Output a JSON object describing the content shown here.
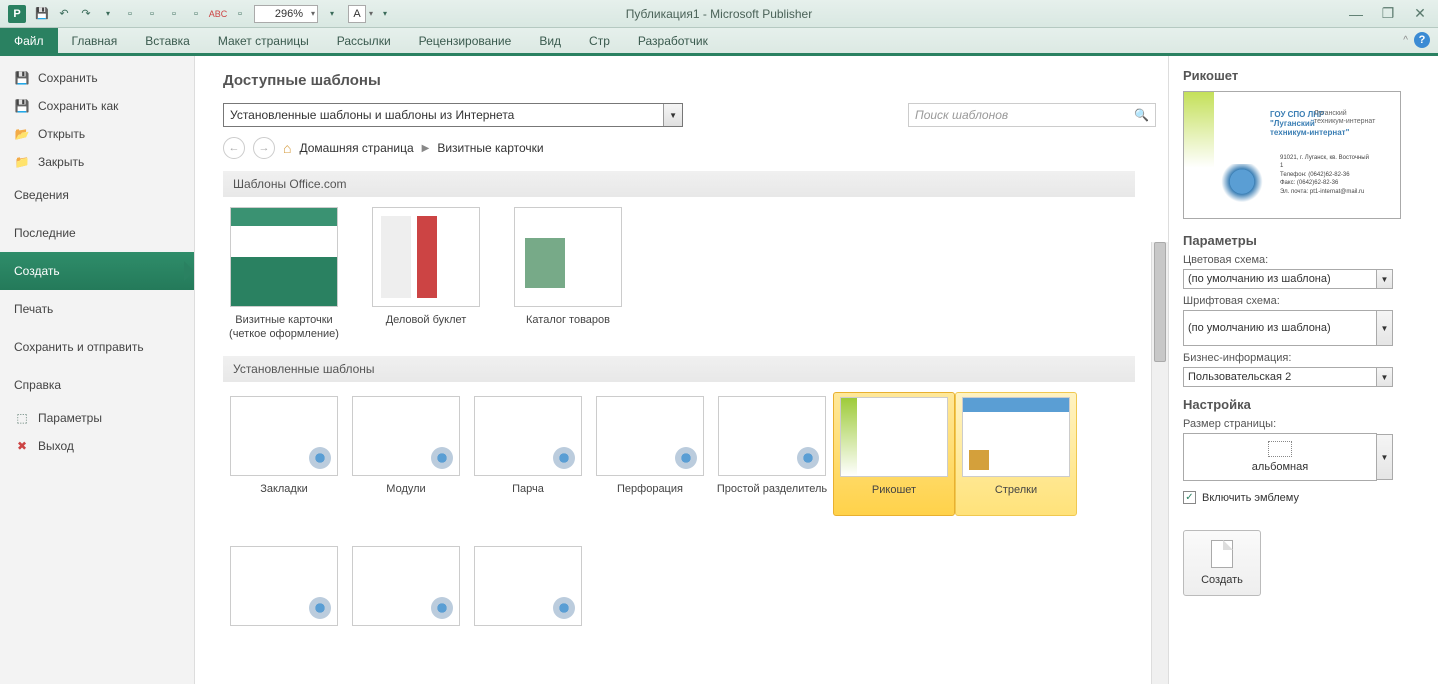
{
  "titlebar": {
    "app_icon_letter": "P",
    "zoom_value": "296%",
    "a_box": "A",
    "window_title": "Публикация1 - Microsoft Publisher"
  },
  "ribbon": {
    "tabs": [
      "Файл",
      "Главная",
      "Вставка",
      "Макет страницы",
      "Рассылки",
      "Рецензирование",
      "Вид",
      "Стр",
      "Разработчик"
    ],
    "active_index": 0
  },
  "sidebar": {
    "items": [
      {
        "label": "Сохранить",
        "icon": "save"
      },
      {
        "label": "Сохранить как",
        "icon": "saveas"
      },
      {
        "label": "Открыть",
        "icon": "open"
      },
      {
        "label": "Закрыть",
        "icon": "close"
      },
      {
        "label": "Сведения",
        "big": true
      },
      {
        "label": "Последние",
        "big": true
      },
      {
        "label": "Создать",
        "big": true,
        "active": true
      },
      {
        "label": "Печать",
        "big": true
      },
      {
        "label": "Сохранить и отправить",
        "big": true
      },
      {
        "label": "Справка",
        "big": true
      },
      {
        "label": "Параметры",
        "icon": "params"
      },
      {
        "label": "Выход",
        "icon": "exit"
      }
    ]
  },
  "center": {
    "heading": "Доступные шаблоны",
    "filter_value": "Установленные шаблоны и шаблоны из Интернета",
    "search_placeholder": "Поиск шаблонов",
    "breadcrumb": {
      "home": "Домашняя страница",
      "current": "Визитные карточки"
    },
    "section1": "Шаблоны Office.com",
    "office_templates": [
      {
        "label": "Визитные карточки (четкое оформление)"
      },
      {
        "label": "Деловой буклет"
      },
      {
        "label": "Каталог товаров"
      }
    ],
    "section2": "Установленные шаблоны",
    "installed_templates": [
      {
        "label": "Закладки"
      },
      {
        "label": "Модули"
      },
      {
        "label": "Парча"
      },
      {
        "label": "Перфорация"
      },
      {
        "label": "Простой разделитель"
      },
      {
        "label": "Рикошет",
        "selected": true
      },
      {
        "label": "Стрелки",
        "highlight": true
      }
    ]
  },
  "rightpanel": {
    "preview_title": "Рикошет",
    "preview_text1": "ГОУ СПО ЛНР\n\"Луганский\nтехникум-интернат\"",
    "preview_text2": "Луганский\nтехникум-интернат",
    "preview_text3": "91021, г. Луганск, кв. Восточный\n1\nТелефон: (0642)62-82-36\nФакс: (0642)62-82-36\nЭл. почта: pt1-internat@mail.ru",
    "section_params": "Параметры",
    "color_scheme_label": "Цветовая схема:",
    "color_scheme_value": "(по умолчанию из шаблона)",
    "font_scheme_label": "Шрифтовая схема:",
    "font_scheme_value": "(по умолчанию из шаблона)",
    "biz_info_label": "Бизнес-информация:",
    "biz_info_value": "Пользовательская 2",
    "section_settings": "Настройка",
    "page_size_label": "Размер страницы:",
    "page_size_value": "альбомная",
    "include_logo_label": "Включить эмблему",
    "include_logo_checked": true,
    "create_button": "Создать"
  }
}
